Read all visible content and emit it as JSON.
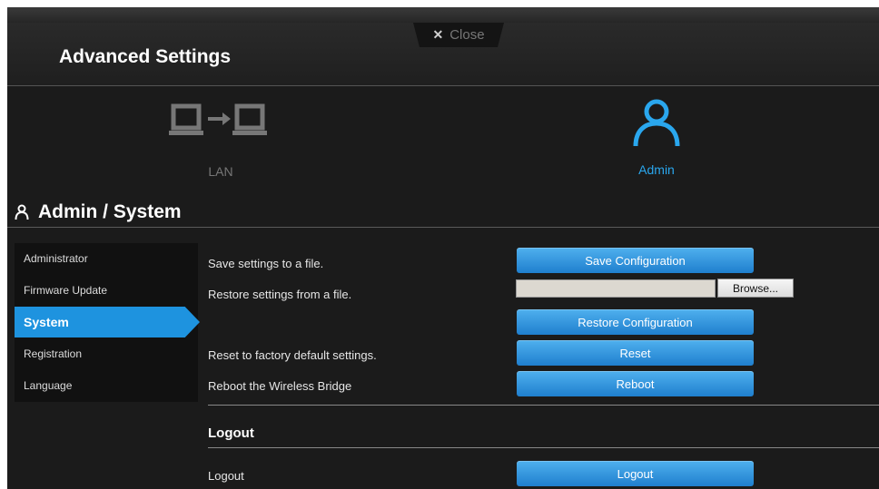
{
  "header": {
    "title": "Advanced Settings",
    "close_label": "Close"
  },
  "nav": [
    {
      "label": "LAN",
      "icon": "lan-transfer-icon",
      "color": "#777777"
    },
    {
      "label": "Admin",
      "icon": "user-icon",
      "color": "#2aa7ee",
      "active": true
    }
  ],
  "section": {
    "title": "Admin / System",
    "icon": "user-icon"
  },
  "sidebar": {
    "items": [
      {
        "label": "Administrator"
      },
      {
        "label": "Firmware Update"
      },
      {
        "label": "System",
        "active": true
      },
      {
        "label": "Registration"
      },
      {
        "label": "Language"
      }
    ]
  },
  "system": {
    "save_label": "Save settings to a file.",
    "save_button": "Save Configuration",
    "restore_label": "Restore settings from a file.",
    "file_value": "",
    "browse_button": "Browse...",
    "restore_button": "Restore Configuration",
    "reset_label": "Reset to factory default settings.",
    "reset_button": "Reset",
    "reboot_label": "Reboot the Wireless Bridge",
    "reboot_button": "Reboot"
  },
  "logout": {
    "title": "Logout",
    "label": "Logout",
    "button": "Logout"
  },
  "colors": {
    "accent": "#1e93df",
    "background": "#1b1b1b",
    "button": "#2a8ad6"
  }
}
